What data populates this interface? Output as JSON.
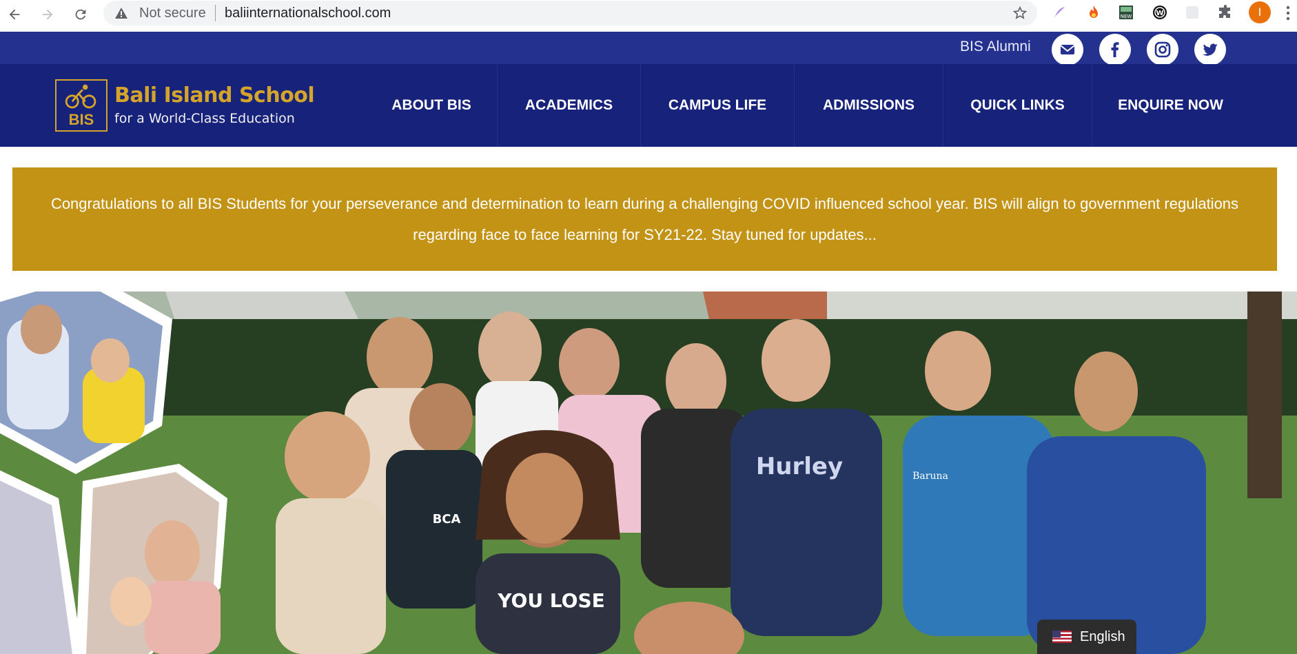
{
  "browser": {
    "security_label": "Not secure",
    "url": "baliinternationalschool.com",
    "profile_initial": "I",
    "extensions": [
      "quill-icon",
      "fire-icon",
      "news-icon",
      "wordpress-icon",
      "blank-extension-icon",
      "puzzle-icon"
    ]
  },
  "topbar": {
    "alumni_label": "BIS Alumni",
    "social": [
      "email-icon",
      "facebook-icon",
      "instagram-icon",
      "twitter-icon"
    ]
  },
  "logo": {
    "mark_text": "BIS",
    "title": "Bali Island School",
    "tagline": "for a World-Class Education"
  },
  "nav": {
    "items": [
      {
        "label": "ABOUT BIS"
      },
      {
        "label": "ACADEMICS"
      },
      {
        "label": "CAMPUS LIFE"
      },
      {
        "label": "ADMISSIONS"
      },
      {
        "label": "QUICK LINKS"
      },
      {
        "label": "ENQUIRE NOW"
      }
    ]
  },
  "notice": {
    "text": "Congratulations to all BIS Students for your perseverance and determination to learn during a challenging COVID influenced school year. BIS will align to government regulations regarding face to face learning for SY21-22. Stay tuned for updates..."
  },
  "hero": {
    "shirt_text_1": "YOU LOSE",
    "shirt_text_2": "BCA",
    "shirt_text_3": "Baruna",
    "shirt_text_4": "Hurley"
  },
  "language": {
    "label": "English"
  },
  "colors": {
    "topbar": "#24318e",
    "nav": "#17227a",
    "gold": "#c39316",
    "logo_gold": "#d4a52a"
  }
}
